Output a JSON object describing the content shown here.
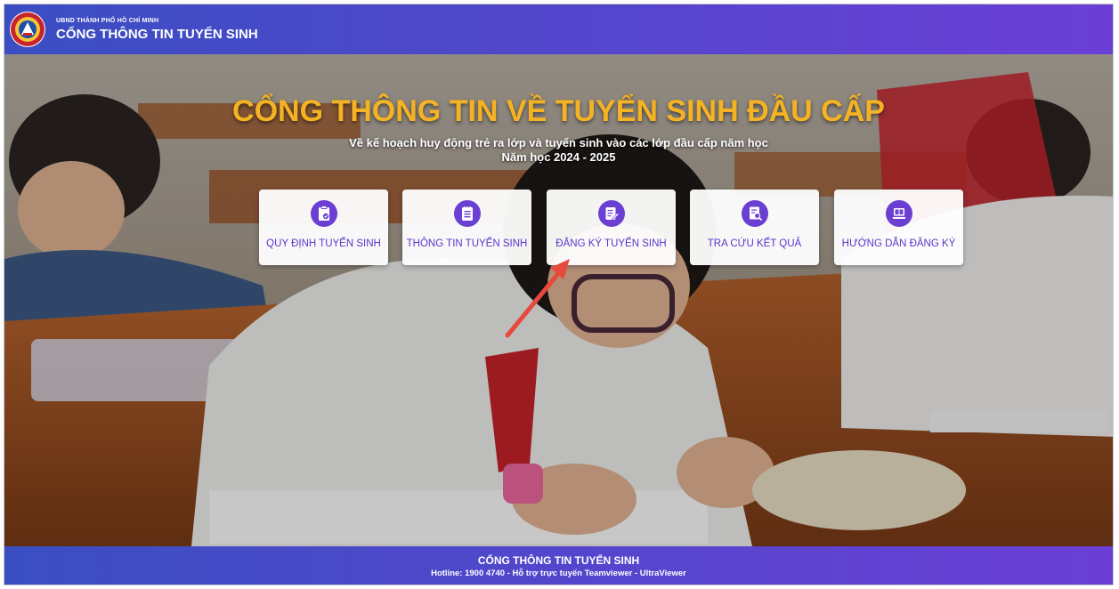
{
  "header": {
    "subtitle": "UBND THÀNH PHỐ HỒ CHÍ MINH",
    "title": "CỔNG THÔNG TIN TUYỂN SINH",
    "logo_icon": "city-emblem-icon"
  },
  "hero": {
    "title": "CỔNG THÔNG TIN VỀ TUYỂN SINH ĐẦU CẤP",
    "subtitle_line1": "Về kế hoạch huy động trẻ ra lớp và tuyển sinh vào các lớp đầu cấp năm học",
    "subtitle_line2": "Năm học 2024 - 2025",
    "background": "students-taking-exam-photo"
  },
  "cards": [
    {
      "label": "QUY ĐỊNH TUYỂN SINH",
      "icon": "clipboard-check-icon"
    },
    {
      "label": "THÔNG TIN TUYỂN SINH",
      "icon": "notepad-list-icon"
    },
    {
      "label": "ĐĂNG KÝ TUYỂN SINH",
      "icon": "form-edit-icon"
    },
    {
      "label": "TRA CỨU KẾT QUẢ",
      "icon": "document-search-icon"
    },
    {
      "label": "HƯỚNG DẪN ĐĂNG KÝ",
      "icon": "laptop-guide-icon"
    }
  ],
  "footer": {
    "title": "CỔNG THÔNG TIN TUYỂN SINH",
    "hotline": "Hotline: 1900 4740 - Hỗ trợ trực tuyến Teamviewer - UltraViewer"
  },
  "colors": {
    "header_gradient_start": "#3a4ec2",
    "header_gradient_end": "#6b3fd6",
    "accent": "#6a3fd1",
    "hero_title": "#f5b324",
    "annotation_arrow": "#e8493d"
  }
}
